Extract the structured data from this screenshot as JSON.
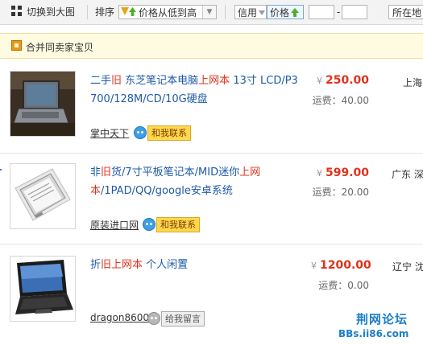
{
  "toolbar": {
    "view_toggle_label": "切换到大图",
    "sort_label": "排序",
    "sort_value": "价格从低到高",
    "credit_label": "信用",
    "price_label": "价格",
    "price_from_placeholder": "",
    "price_to_placeholder": "",
    "price_dash": "-",
    "location_label": "所在地"
  },
  "merge": {
    "label": "合并同卖家宝贝"
  },
  "items": [
    {
      "title_parts": [
        "二手",
        "旧",
        " 东芝笔记本电脑",
        "上网本",
        " 13寸 LCD/P3 700/128M/CD/10G硬盘"
      ],
      "currency": "¥",
      "price": "250.00",
      "shipping": "运费：40.00",
      "location": "上海",
      "seller": "掌中天下",
      "contact": "和我联系",
      "contact_status": "online"
    },
    {
      "title_parts": [
        "非",
        "旧",
        "货/7寸平板笔记本/MID迷你",
        "上网本",
        "/1PAD/QQ/google安卓系统"
      ],
      "currency": "¥",
      "price": "599.00",
      "shipping": "运费：20.00",
      "location": "广东 深",
      "seller": "原装进口网",
      "contact": "和我联系",
      "contact_status": "online"
    },
    {
      "title_parts": [
        "折",
        "旧",
        "上网本",
        " 个人闲置",
        ""
      ],
      "currency": "¥",
      "price": "1200.00",
      "shipping": "运费：0.00",
      "location": "辽宁 沈",
      "seller": "dragon8600",
      "contact": "给我留言",
      "contact_status": "offline"
    }
  ],
  "watermark": {
    "line1": "荆网论坛",
    "line2": "BBs.ii86.com"
  },
  "colors": {
    "highlight": "#e0321b",
    "link": "#1f5aa8",
    "price": "#e0321b",
    "watermark": "#1d7ec8"
  }
}
